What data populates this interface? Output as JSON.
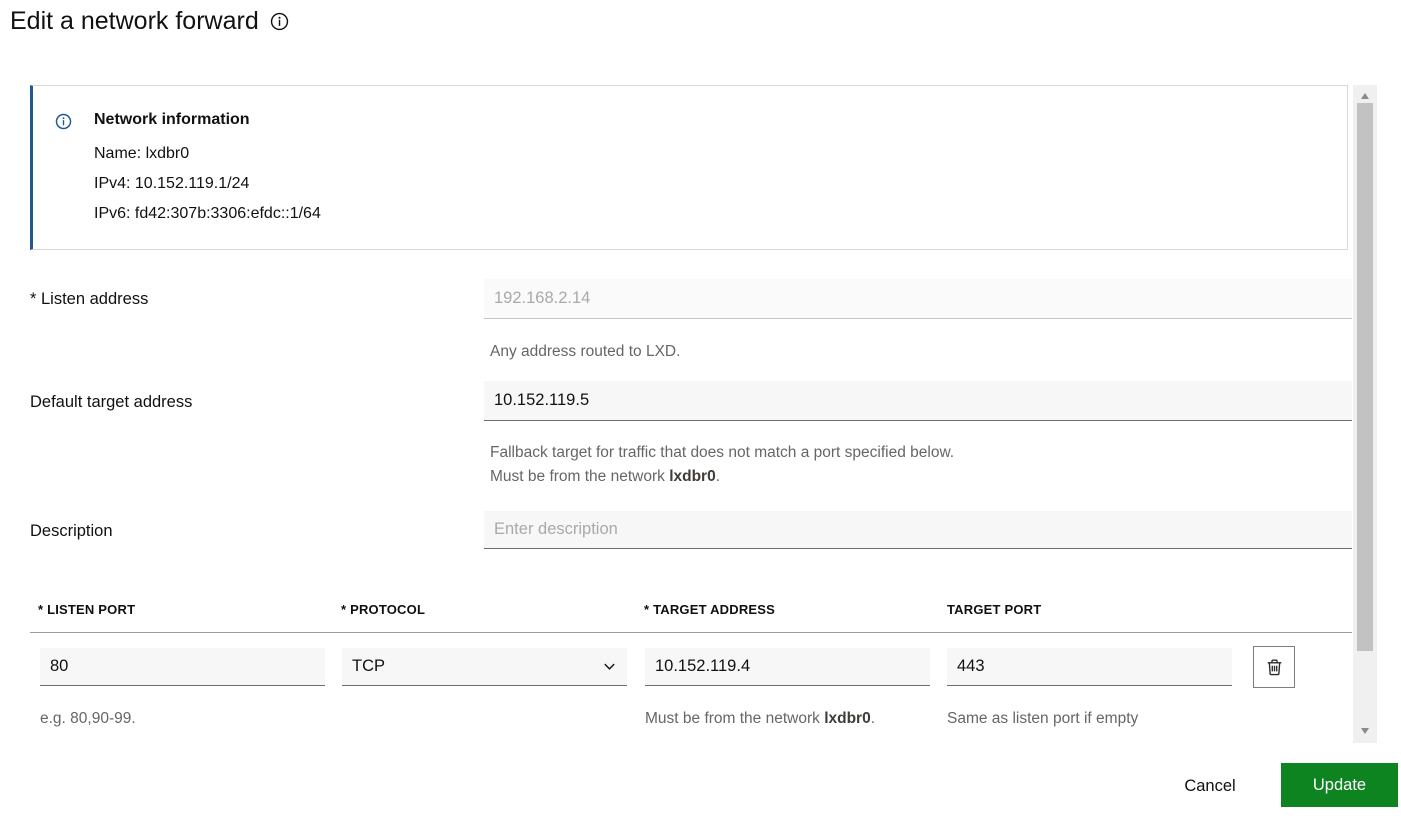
{
  "header": {
    "title": "Edit a network forward"
  },
  "notification": {
    "title": "Network information",
    "line_name": "Name: lxdbr0",
    "line_ipv4": "IPv4: 10.152.119.1/24",
    "line_ipv6": "IPv6: fd42:307b:3306:efdc::1/64"
  },
  "form": {
    "listen_address": {
      "label": "* Listen address",
      "value": "192.168.2.14",
      "help": "Any address routed to LXD."
    },
    "default_target": {
      "label": "Default target address",
      "value": "10.152.119.5",
      "help_line1": "Fallback target for traffic that does not match a port specified below.",
      "help_line2_prefix": "Must be from the network ",
      "help_network": "lxdbr0",
      "help_line2_suffix": "."
    },
    "description": {
      "label": "Description",
      "placeholder": "Enter description"
    }
  },
  "ports": {
    "headers": {
      "listen_port": "* LISTEN PORT",
      "protocol": "* PROTOCOL",
      "target_address": "* TARGET ADDRESS",
      "target_port": "TARGET PORT"
    },
    "row": {
      "listen_port": "80",
      "listen_port_help": "e.g. 80,90-99.",
      "protocol": "TCP",
      "target_address": "10.152.119.4",
      "target_help_prefix": "Must be from the network ",
      "target_help_network": "lxdbr0",
      "target_help_suffix": ".",
      "target_port": "443",
      "target_port_help": "Same as listen port if empty"
    }
  },
  "footer": {
    "cancel": "Cancel",
    "update": "Update"
  },
  "colors": {
    "positive_green": "#0e8420",
    "info_blue": "#24598f"
  }
}
